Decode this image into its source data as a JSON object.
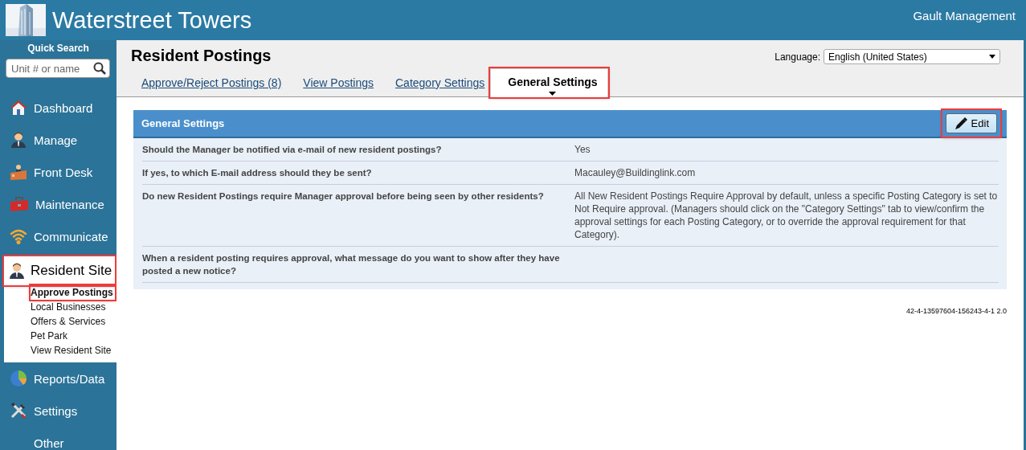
{
  "header": {
    "title": "Waterstreet Towers",
    "account": "Gault Management"
  },
  "sidebar": {
    "search": {
      "label": "Quick Search",
      "placeholder": "Unit # or name"
    },
    "items": [
      {
        "label": "Dashboard",
        "kind": "house",
        "expanded": false,
        "highlighted": false
      },
      {
        "label": "Manage",
        "kind": "person",
        "expanded": false,
        "highlighted": false
      },
      {
        "label": "Front Desk",
        "kind": "desk",
        "expanded": false,
        "highlighted": false
      },
      {
        "label": "Maintenance",
        "kind": "toolbox",
        "expanded": false,
        "highlighted": false
      },
      {
        "label": "Communicate",
        "kind": "wifi",
        "expanded": false,
        "highlighted": false
      },
      {
        "label": "Resident Site",
        "kind": "person",
        "expanded": true,
        "highlighted": true,
        "children": [
          {
            "label": "Approve Postings",
            "selected": true,
            "highlighted": true
          },
          {
            "label": "Local Businesses",
            "selected": false,
            "highlighted": false
          },
          {
            "label": "Offers & Services",
            "selected": false,
            "highlighted": false
          },
          {
            "label": "Pet Park",
            "selected": false,
            "highlighted": false
          },
          {
            "label": "View Resident Site",
            "selected": false,
            "highlighted": false
          }
        ]
      },
      {
        "label": "Reports/Data",
        "kind": "pie",
        "expanded": false,
        "highlighted": false
      },
      {
        "label": "Settings",
        "kind": "tools",
        "expanded": false,
        "highlighted": false
      },
      {
        "label": "Other",
        "kind": "plain",
        "expanded": false,
        "highlighted": false
      }
    ]
  },
  "page": {
    "title": "Resident Postings",
    "language": {
      "label": "Language:",
      "value": "English (United States)"
    },
    "tabs": [
      {
        "label": "Approve/Reject Postings (8)",
        "selected": false,
        "highlighted": false
      },
      {
        "label": "View Postings",
        "selected": false,
        "highlighted": false
      },
      {
        "label": "Category Settings",
        "selected": false,
        "highlighted": false
      },
      {
        "label": "General Settings",
        "selected": true,
        "highlighted": true
      }
    ],
    "panel": {
      "title": "General Settings",
      "edit_button": {
        "label": "Edit",
        "highlighted": true
      },
      "rows": [
        {
          "question": "Should the Manager be notified via e-mail of new resident postings?",
          "answer": "Yes"
        },
        {
          "question": "If yes, to which E-mail address should they be sent?",
          "answer": "Macauley@Buildinglink.com"
        },
        {
          "question": "Do new Resident Postings require Manager approval before being seen by other residents?",
          "answer": "All New Resident Postings Require Approval by default, unless a specific Posting Category is set to Not Require approval. (Managers should click on the \"Category Settings\" tab to view/confirm the approval settings for each Posting Category, or to override the approval requirement for that Category)."
        },
        {
          "question": "When a resident posting requires approval, what message do you want to show after they have posted a new notice?"
        }
      ]
    },
    "version": "42-4-13597604-156243-4-1 2.0"
  }
}
